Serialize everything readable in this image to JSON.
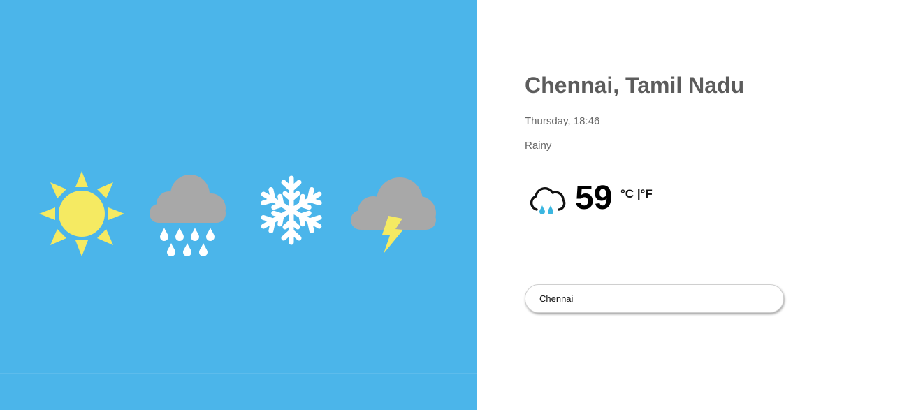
{
  "hero": {
    "background_color": "#4bb5ea",
    "icons": [
      "sun-icon",
      "rain-cloud-icon",
      "snowflake-icon",
      "thunderstorm-icon"
    ]
  },
  "weather": {
    "location": "Chennai, Tamil Nadu",
    "datetime": "Thursday, 18:46",
    "condition": "Rainy",
    "condition_icon": "rain-cloud-icon",
    "temperature": "59",
    "unit_celsius": "°C",
    "unit_separator": "|",
    "unit_fahrenheit": "°F"
  },
  "search": {
    "value": "Chennai"
  },
  "colors": {
    "sun": "#f5ea62",
    "cloud": "#a8a8a8",
    "snow": "#ffffff",
    "bolt": "#f5ea62",
    "rain_drop": "#3bb6e0"
  }
}
